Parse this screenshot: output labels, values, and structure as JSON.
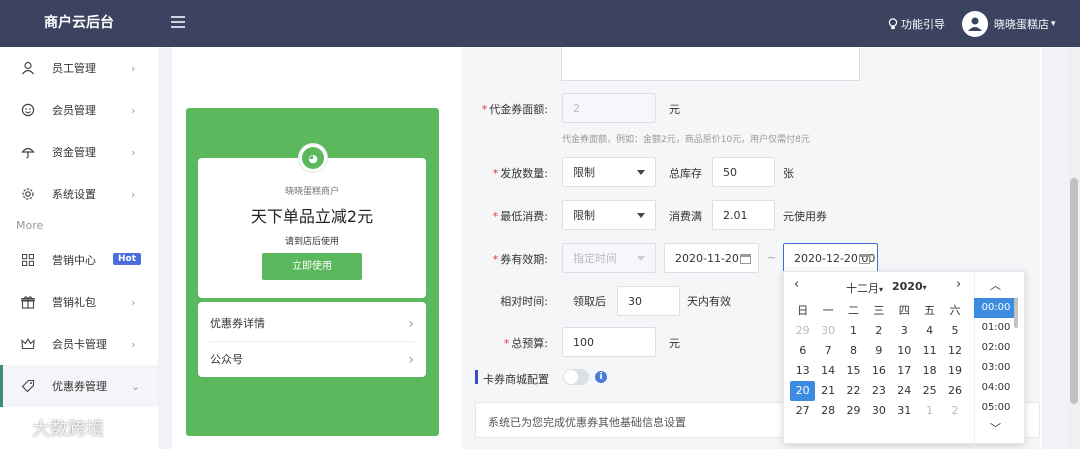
{
  "header": {
    "brand": "商户云后台",
    "guide_label": "功能引导",
    "user_name": "晓晓蛋糕店",
    "user_caret": "▾"
  },
  "sidebar": {
    "more_label": "More",
    "items": [
      {
        "label": "员工管理",
        "icon": "user-icon"
      },
      {
        "label": "会员管理",
        "icon": "smile-icon"
      },
      {
        "label": "资金管理",
        "icon": "umbrella-icon"
      },
      {
        "label": "系统设置",
        "icon": "gear-icon"
      },
      {
        "label": "营销中心",
        "icon": "grid-icon",
        "badge": "Hot"
      },
      {
        "label": "营销礼包",
        "icon": "gift-icon"
      },
      {
        "label": "会员卡管理",
        "icon": "crown-icon"
      },
      {
        "label": "优惠券管理",
        "icon": "tag-icon"
      }
    ]
  },
  "preview": {
    "merchant": "晓晓蛋糕商户",
    "title": "天下单品立减2元",
    "hint": "请到店后使用",
    "button": "立即使用",
    "links": [
      "优惠券详情",
      "公众号"
    ]
  },
  "form": {
    "amount": {
      "label": "代金券面额:",
      "placeholder": "2",
      "unit": "元",
      "note": "代金券面额，例如：金额2元，商品原价10元，用户仅需付8元"
    },
    "quantity": {
      "label": "发放数量:",
      "select": "限制",
      "stock_label": "总库存",
      "stock": "50",
      "unit": "张"
    },
    "min_spend": {
      "label": "最低消费:",
      "select": "限制",
      "prefix": "消费满",
      "value": "2.01",
      "suffix": "元使用券"
    },
    "validity": {
      "label": "券有效期:",
      "mode_placeholder": "指定时间",
      "start": "2020-11-20",
      "separator": "~",
      "end": "2020-12-20 00"
    },
    "relative": {
      "label": "相对时间:",
      "prefix": "领取后",
      "value": "30",
      "suffix": "天内有效"
    },
    "budget": {
      "label": "总预算:",
      "value": "100",
      "unit": "元"
    },
    "mall_config": {
      "label": "卡券商城配置"
    },
    "system_notice": "系统已为您完成优惠券其他基础信息设置"
  },
  "datepicker": {
    "month": "十二月",
    "year": "2020",
    "weekdays": [
      "日",
      "一",
      "二",
      "三",
      "四",
      "五",
      "六"
    ],
    "weeks": [
      [
        "29",
        "30",
        "1",
        "2",
        "3",
        "4",
        "5"
      ],
      [
        "6",
        "7",
        "8",
        "9",
        "10",
        "11",
        "12"
      ],
      [
        "13",
        "14",
        "15",
        "16",
        "17",
        "18",
        "19"
      ],
      [
        "20",
        "21",
        "22",
        "23",
        "24",
        "25",
        "26"
      ],
      [
        "27",
        "28",
        "29",
        "30",
        "31",
        "1",
        "2"
      ]
    ],
    "selected_day": "20",
    "times": [
      "00:00",
      "01:00",
      "02:00",
      "03:00",
      "04:00",
      "05:00"
    ],
    "selected_time": "00:00"
  },
  "watermark": "大数跨境"
}
